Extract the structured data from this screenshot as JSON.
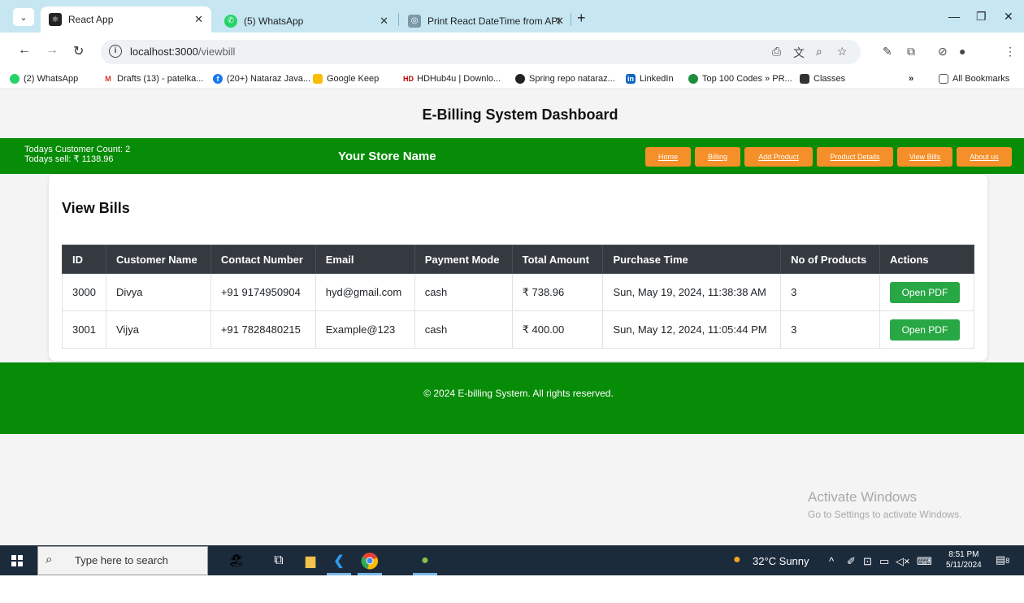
{
  "browser": {
    "tabs": [
      {
        "title": "React App",
        "icon": "react-icon",
        "color": "#222222"
      },
      {
        "title": "(5) WhatsApp",
        "icon": "whatsapp-icon",
        "color": "#25d366"
      },
      {
        "title": "Print React DateTime from API",
        "icon": "globe-icon",
        "color": "#7a9aa8"
      }
    ],
    "address": {
      "host": "localhost:3000",
      "path": "/viewbill"
    },
    "bookmarks": [
      {
        "label": "(2) WhatsApp",
        "icon": "whatsapp-icon",
        "color": "#25d366"
      },
      {
        "label": "Drafts (13) - patelka...",
        "icon": "gmail-icon",
        "color": "#d93025"
      },
      {
        "label": "(20+) Nataraz Java...",
        "icon": "facebook-icon",
        "color": "#1877f2"
      },
      {
        "label": "Google Keep",
        "icon": "keep-icon",
        "color": "#fbbc04"
      },
      {
        "label": "HDHub4u | Downlo...",
        "icon": "hd-icon",
        "color": "#c00000"
      },
      {
        "label": "Spring repo nataraz...",
        "icon": "github-icon",
        "color": "#222222"
      },
      {
        "label": "LinkedIn",
        "icon": "linkedin-icon",
        "color": "#0a66c2"
      },
      {
        "label": "Top 100 Codes » PR...",
        "icon": "code-icon",
        "color": "#1e8e3e"
      },
      {
        "label": "Classes",
        "icon": "classroom-icon",
        "color": "#333333"
      }
    ],
    "all_bookmarks": "All Bookmarks"
  },
  "app": {
    "dashboard_title": "E-Billing System Dashboard",
    "customer_count": "Todays Customer Count: 2",
    "todays_sell": "Todays sell: ₹ 1138.96",
    "store_name": "Your Store Name",
    "nav": [
      "Home",
      "Billing",
      "Add Product",
      "Product Details",
      "View Bills",
      "About us"
    ],
    "section_title": "View Bills",
    "table": {
      "headers": [
        "ID",
        "Customer Name",
        "Contact Number",
        "Email",
        "Payment Mode",
        "Total Amount",
        "Purchase Time",
        "No of Products",
        "Actions"
      ],
      "rows": [
        [
          "3000",
          "Divya",
          "+91 9174950904",
          "hyd@gmail.com",
          "cash",
          "₹ 738.96",
          "Sun, May 19, 2024, 11:38:38 AM",
          "3",
          "Open PDF"
        ],
        [
          "3001",
          "Vijya",
          "+91 7828480215",
          "Example@123",
          "cash",
          "₹ 400.00",
          "Sun, May 12, 2024, 11:05:44 PM",
          "3",
          "Open PDF"
        ]
      ]
    },
    "footer": "© 2024 E-billing System. All rights reserved."
  },
  "watermark": {
    "line1": "Activate Windows",
    "line2": "Go to Settings to activate Windows."
  },
  "taskbar": {
    "search_placeholder": "Type here to search",
    "weather": "32°C  Sunny",
    "time": "8:51 PM",
    "date": "5/11/2024",
    "notification_count": "8"
  },
  "colors": {
    "green": "#078c07",
    "orange": "#f58f29",
    "table_header": "#343a40",
    "pdf_button": "#28a745"
  }
}
